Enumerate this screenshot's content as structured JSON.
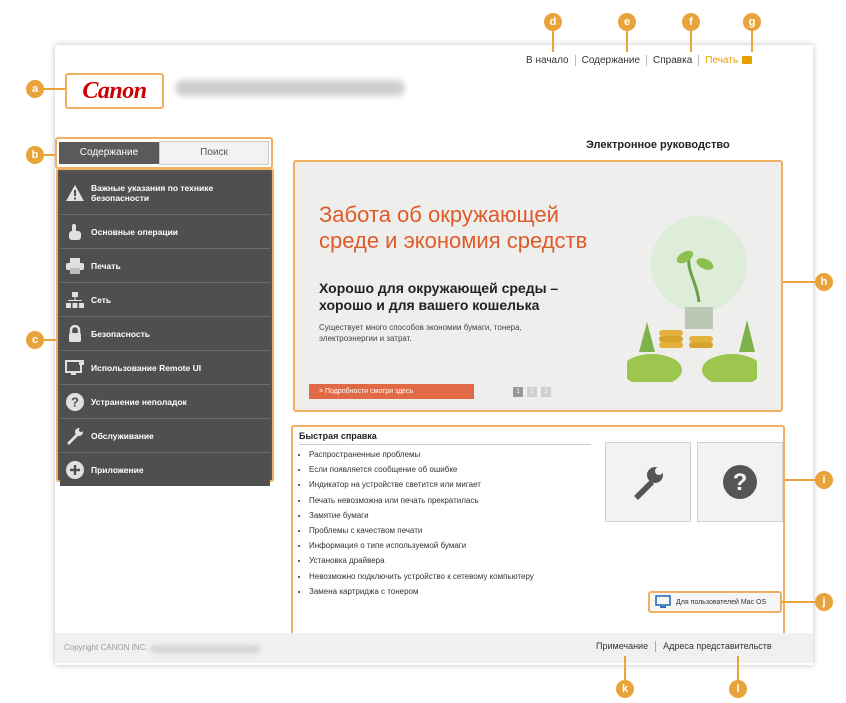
{
  "brand": {
    "logo_text": "Canon"
  },
  "top_nav": {
    "home": "В начало",
    "contents": "Содержание",
    "help": "Справка",
    "print": "Печать"
  },
  "tabs": {
    "contents": "Содержание",
    "search": "Поиск"
  },
  "sidebar": {
    "items": [
      {
        "label": "Важные указания по технике безопасности",
        "icon": "warning-icon"
      },
      {
        "label": "Основные операции",
        "icon": "hand-icon"
      },
      {
        "label": "Печать",
        "icon": "printer-icon"
      },
      {
        "label": "Сеть",
        "icon": "network-icon"
      },
      {
        "label": "Безопасность",
        "icon": "lock-icon"
      },
      {
        "label": "Использование Remote UI",
        "icon": "monitor-icon"
      },
      {
        "label": "Устранение неполадок",
        "icon": "question-icon"
      },
      {
        "label": "Обслуживание",
        "icon": "wrench-icon"
      },
      {
        "label": "Приложение",
        "icon": "plus-icon"
      }
    ]
  },
  "guide_title": "Электронное руководство",
  "banner": {
    "headline": "Забота об окружающей среде и экономия средств",
    "subheadline": "Хорошо для окружающей среды – хорошо и для вашего кошелька",
    "text": "Существует много способов экономии бумаги, тонера, электроэнергии и затрат.",
    "cta": "> Подробности смотри здесь",
    "pages": [
      "1",
      "2",
      "3"
    ]
  },
  "quick": {
    "title": "Быстрая справка",
    "items": [
      "Распространенные проблемы",
      "Если появляется сообщение об ошибке",
      "Индикатор на устройстве светится или мигает",
      "Печать невозможна или печать прекратилась",
      "Замятие бумаги",
      "Проблемы с качеством печати",
      "Информация о типе используемой бумаги",
      "Установка драйвера",
      "Невозможно подключить устройство к сетевому компьютеру",
      "Замена картриджа с тонером"
    ]
  },
  "mac_button": "Для пользователей Mac OS",
  "footer": {
    "copyright": "Copyright CANON INC.",
    "notice": "Примечание",
    "offices": "Адреса представительств"
  },
  "callouts": [
    "a",
    "b",
    "c",
    "d",
    "e",
    "f",
    "g",
    "h",
    "i",
    "j",
    "k",
    "l"
  ],
  "colors": {
    "accent": "#e8a33a",
    "sidebar": "#4f4f4f",
    "banner_headline": "#e05a2a",
    "print_link": "#e8a000",
    "logo": "#cc0000"
  }
}
